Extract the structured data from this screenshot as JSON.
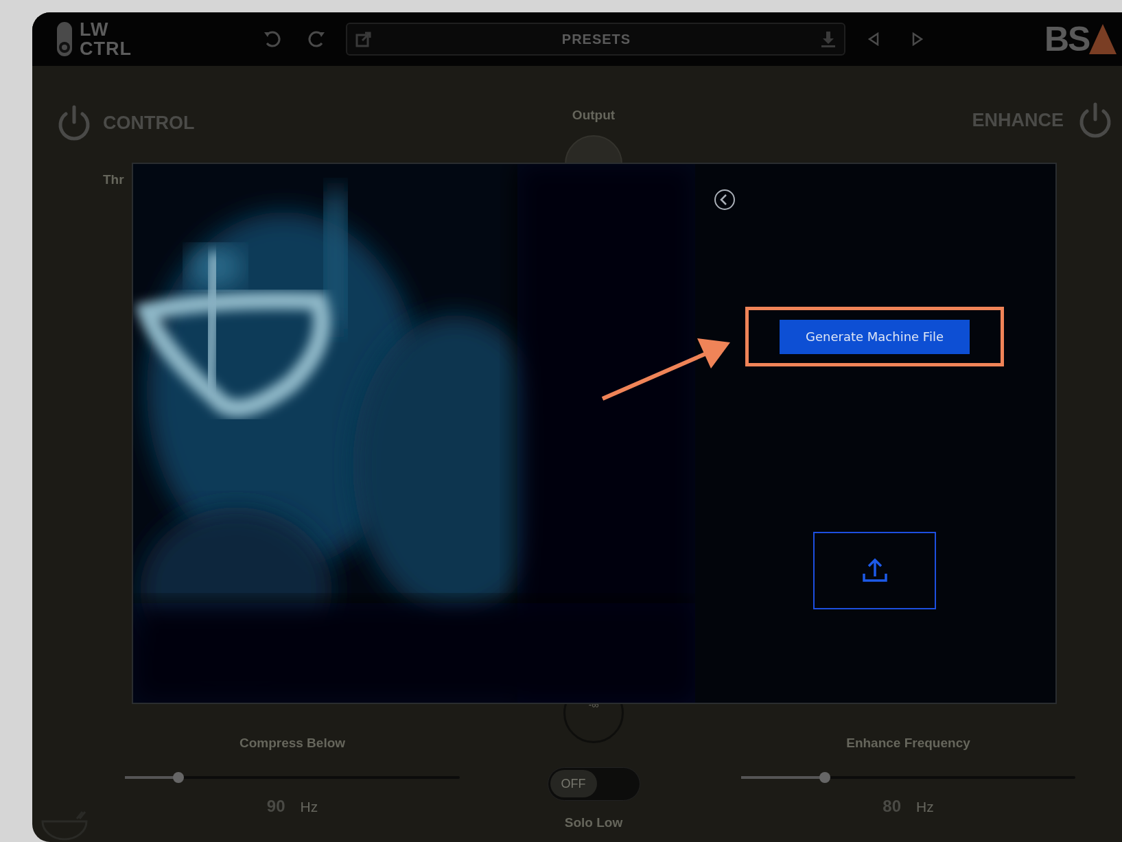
{
  "toolbar": {
    "logo_lines": [
      "LW",
      "CTRL"
    ],
    "presets": {
      "label": "PRESETS"
    },
    "brand": "BS"
  },
  "left_section": {
    "title": "CONTROL",
    "threshold_label": "Thr"
  },
  "right_section": {
    "title": "ENHANCE"
  },
  "output": {
    "label": "Output",
    "meter_reading": "-∞"
  },
  "modal": {
    "button": "Generate Machine File"
  },
  "sliders": [
    {
      "label": "Compress Below",
      "level": 0.16,
      "value": "90",
      "unit": "Hz"
    },
    {
      "label": "Enhance Frequency",
      "level": 0.25,
      "value": "80",
      "unit": "Hz"
    }
  ],
  "solo": {
    "label": "Solo Low",
    "state_text": "OFF",
    "on": false
  }
}
